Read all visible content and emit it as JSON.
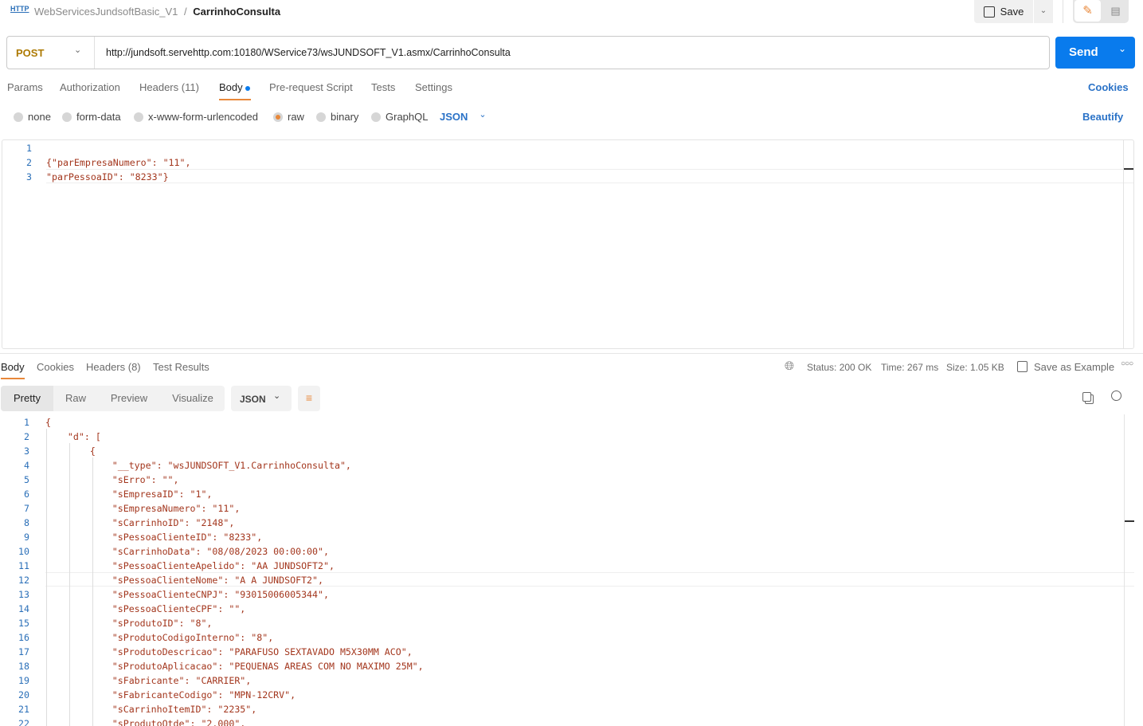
{
  "header": {
    "icon": "http-icon",
    "collection": "WebServicesJundsoftBasic_V1",
    "separator": "/",
    "request_name": "CarrinhoConsulta",
    "save_label": "Save"
  },
  "request": {
    "method": "POST",
    "url": "http://jundsoft.servehttp.com:10180/WService73/wsJUNDSOFT_V1.asmx/CarrinhoConsulta",
    "send_label": "Send"
  },
  "tabs": {
    "items": [
      "Params",
      "Authorization",
      "Headers (11)",
      "Body",
      "Pre-request Script",
      "Tests",
      "Settings"
    ],
    "active": "Body",
    "cookies": "Cookies"
  },
  "body_types": {
    "items": [
      "none",
      "form-data",
      "x-www-form-urlencoded",
      "raw",
      "binary",
      "GraphQL"
    ],
    "selected": "raw",
    "format": "JSON",
    "beautify": "Beautify"
  },
  "request_body": {
    "lines": [
      "",
      "{\"parEmpresaNumero\": \"11\",",
      "\"parPessoaID\": \"8233\"}"
    ]
  },
  "response": {
    "tabs": [
      "Body",
      "Cookies",
      "Headers (8)",
      "Test Results"
    ],
    "active_tab": "Body",
    "status": "Status: 200 OK",
    "time": "Time: 267 ms",
    "size": "Size: 1.05 KB",
    "save_example": "Save as Example",
    "views": [
      "Pretty",
      "Raw",
      "Preview",
      "Visualize"
    ],
    "active_view": "Pretty",
    "format": "JSON",
    "lines": [
      "{",
      "    \"d\": [",
      "        {",
      "            \"__type\": \"wsJUNDSOFT_V1.CarrinhoConsulta\",",
      "            \"sErro\": \"\",",
      "            \"sEmpresaID\": \"1\",",
      "            \"sEmpresaNumero\": \"11\",",
      "            \"sCarrinhoID\": \"2148\",",
      "            \"sPessoaClienteID\": \"8233\",",
      "            \"sCarrinhoData\": \"08/08/2023 00:00:00\",",
      "            \"sPessoaClienteApelido\": \"AA JUNDSOFT2\",",
      "            \"sPessoaClienteNome\": \"A A JUNDSOFT2\",",
      "            \"sPessoaClienteCNPJ\": \"93015006005344\",",
      "            \"sPessoaClienteCPF\": \"\",",
      "            \"sProdutoID\": \"8\",",
      "            \"sProdutoCodigoInterno\": \"8\",",
      "            \"sProdutoDescricao\": \"PARAFUSO SEXTAVADO M5X30MM ACO\",",
      "            \"sProdutoAplicacao\": \"PEQUENAS AREAS COM NO MAXIMO 25M\",",
      "            \"sFabricante\": \"CARRIER\",",
      "            \"sFabricanteCodigo\": \"MPN-12CRV\",",
      "            \"sCarrinhoItemID\": \"2235\",",
      "            \"sProdutoQtde\": \"2.000\","
    ]
  },
  "colors": {
    "accent": "#e8883a",
    "primary": "#097bed",
    "key": "#a3361d",
    "value": "#0f4fa8"
  }
}
